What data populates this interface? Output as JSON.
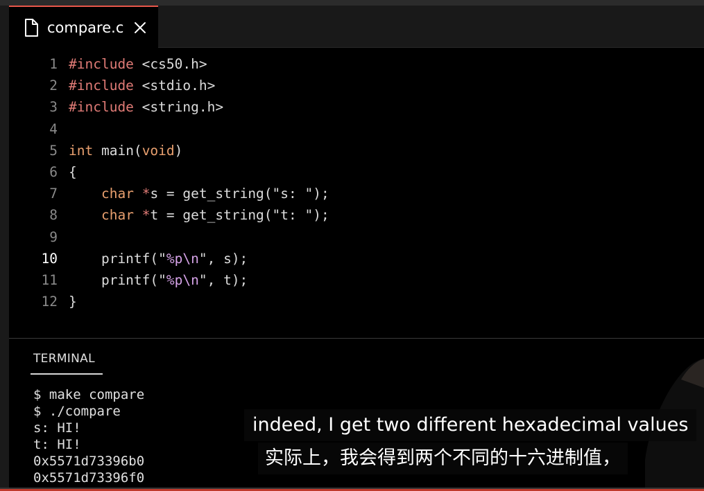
{
  "tab": {
    "filename": "compare.c",
    "icon": "file-icon",
    "close_icon": "close-icon"
  },
  "editor": {
    "lines": [
      {
        "n": "1",
        "parts": [
          [
            "pp",
            "#include"
          ],
          [
            "txt",
            " <cs50.h>"
          ]
        ]
      },
      {
        "n": "2",
        "parts": [
          [
            "pp",
            "#include"
          ],
          [
            "txt",
            " <stdio.h>"
          ]
        ]
      },
      {
        "n": "3",
        "parts": [
          [
            "pp",
            "#include"
          ],
          [
            "txt",
            " <string.h>"
          ]
        ]
      },
      {
        "n": "4",
        "parts": []
      },
      {
        "n": "5",
        "parts": [
          [
            "type",
            "int"
          ],
          [
            "txt",
            " main("
          ],
          [
            "type",
            "void"
          ],
          [
            "txt",
            ")"
          ]
        ]
      },
      {
        "n": "6",
        "parts": [
          [
            "txt",
            "{"
          ]
        ]
      },
      {
        "n": "7",
        "parts": [
          [
            "txt",
            "    "
          ],
          [
            "type",
            "char"
          ],
          [
            "txt",
            " "
          ],
          [
            "pp",
            "*"
          ],
          [
            "txt",
            "s = get_string(\"s: \");"
          ]
        ]
      },
      {
        "n": "8",
        "parts": [
          [
            "txt",
            "    "
          ],
          [
            "type",
            "char"
          ],
          [
            "txt",
            " "
          ],
          [
            "pp",
            "*"
          ],
          [
            "txt",
            "t = get_string(\"t: \");"
          ]
        ]
      },
      {
        "n": "9",
        "parts": []
      },
      {
        "n": "10",
        "active": true,
        "parts": [
          [
            "txt",
            "    printf(\""
          ],
          [
            "esc",
            "%p\\n"
          ],
          [
            "txt",
            "\", s);"
          ]
        ]
      },
      {
        "n": "11",
        "parts": [
          [
            "txt",
            "    printf(\""
          ],
          [
            "esc",
            "%p\\n"
          ],
          [
            "txt",
            "\", t);"
          ]
        ]
      },
      {
        "n": "12",
        "parts": [
          [
            "txt",
            "}"
          ]
        ]
      }
    ]
  },
  "terminal": {
    "tab_label": "TERMINAL",
    "lines": [
      "$ make compare",
      "$ ./compare",
      "s: HI!",
      "t: HI!",
      "0x5571d73396b0",
      "0x5571d73396f0"
    ]
  },
  "subtitles": {
    "english": "indeed, I get two different hexadecimal values",
    "chinese": "实际上，我会得到两个不同的十六进制值，"
  },
  "colors": {
    "accent_tab": "#e8574a",
    "preprocessor": "#e07b76",
    "type_keyword": "#e9a06f",
    "escape": "#d6a3e8"
  }
}
